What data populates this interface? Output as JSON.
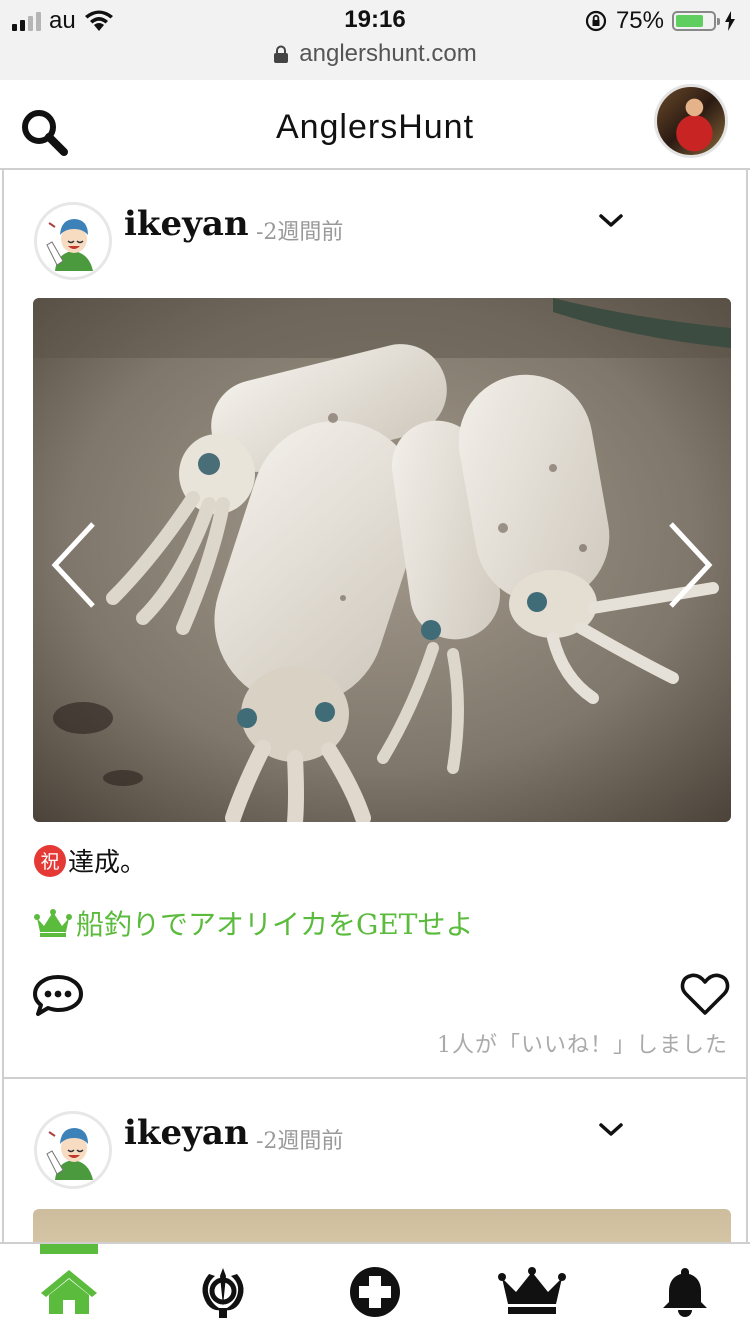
{
  "status_bar": {
    "carrier": "au",
    "time": "19:16",
    "battery_percent": "75%",
    "battery_level": 0.75,
    "url": "anglershunt.com"
  },
  "header": {
    "title": "AnglersHunt"
  },
  "posts": [
    {
      "username": "ikeyan",
      "time_ago": "-2週間前",
      "caption_badge": "祝",
      "caption": "達成。",
      "achievement": "船釣りでアオリイカをGETせよ",
      "likes_text": "1人が「いいね！」しました"
    },
    {
      "username": "ikeyan",
      "time_ago": "-2週間前"
    }
  ],
  "tab_bar": {
    "active_tab": "home",
    "tabs": [
      "home-icon",
      "khanda-icon",
      "add-post-icon",
      "crown-icon",
      "bell-icon"
    ]
  },
  "colors": {
    "accent_green": "#5bbb3c",
    "badge_red": "#e53935"
  }
}
